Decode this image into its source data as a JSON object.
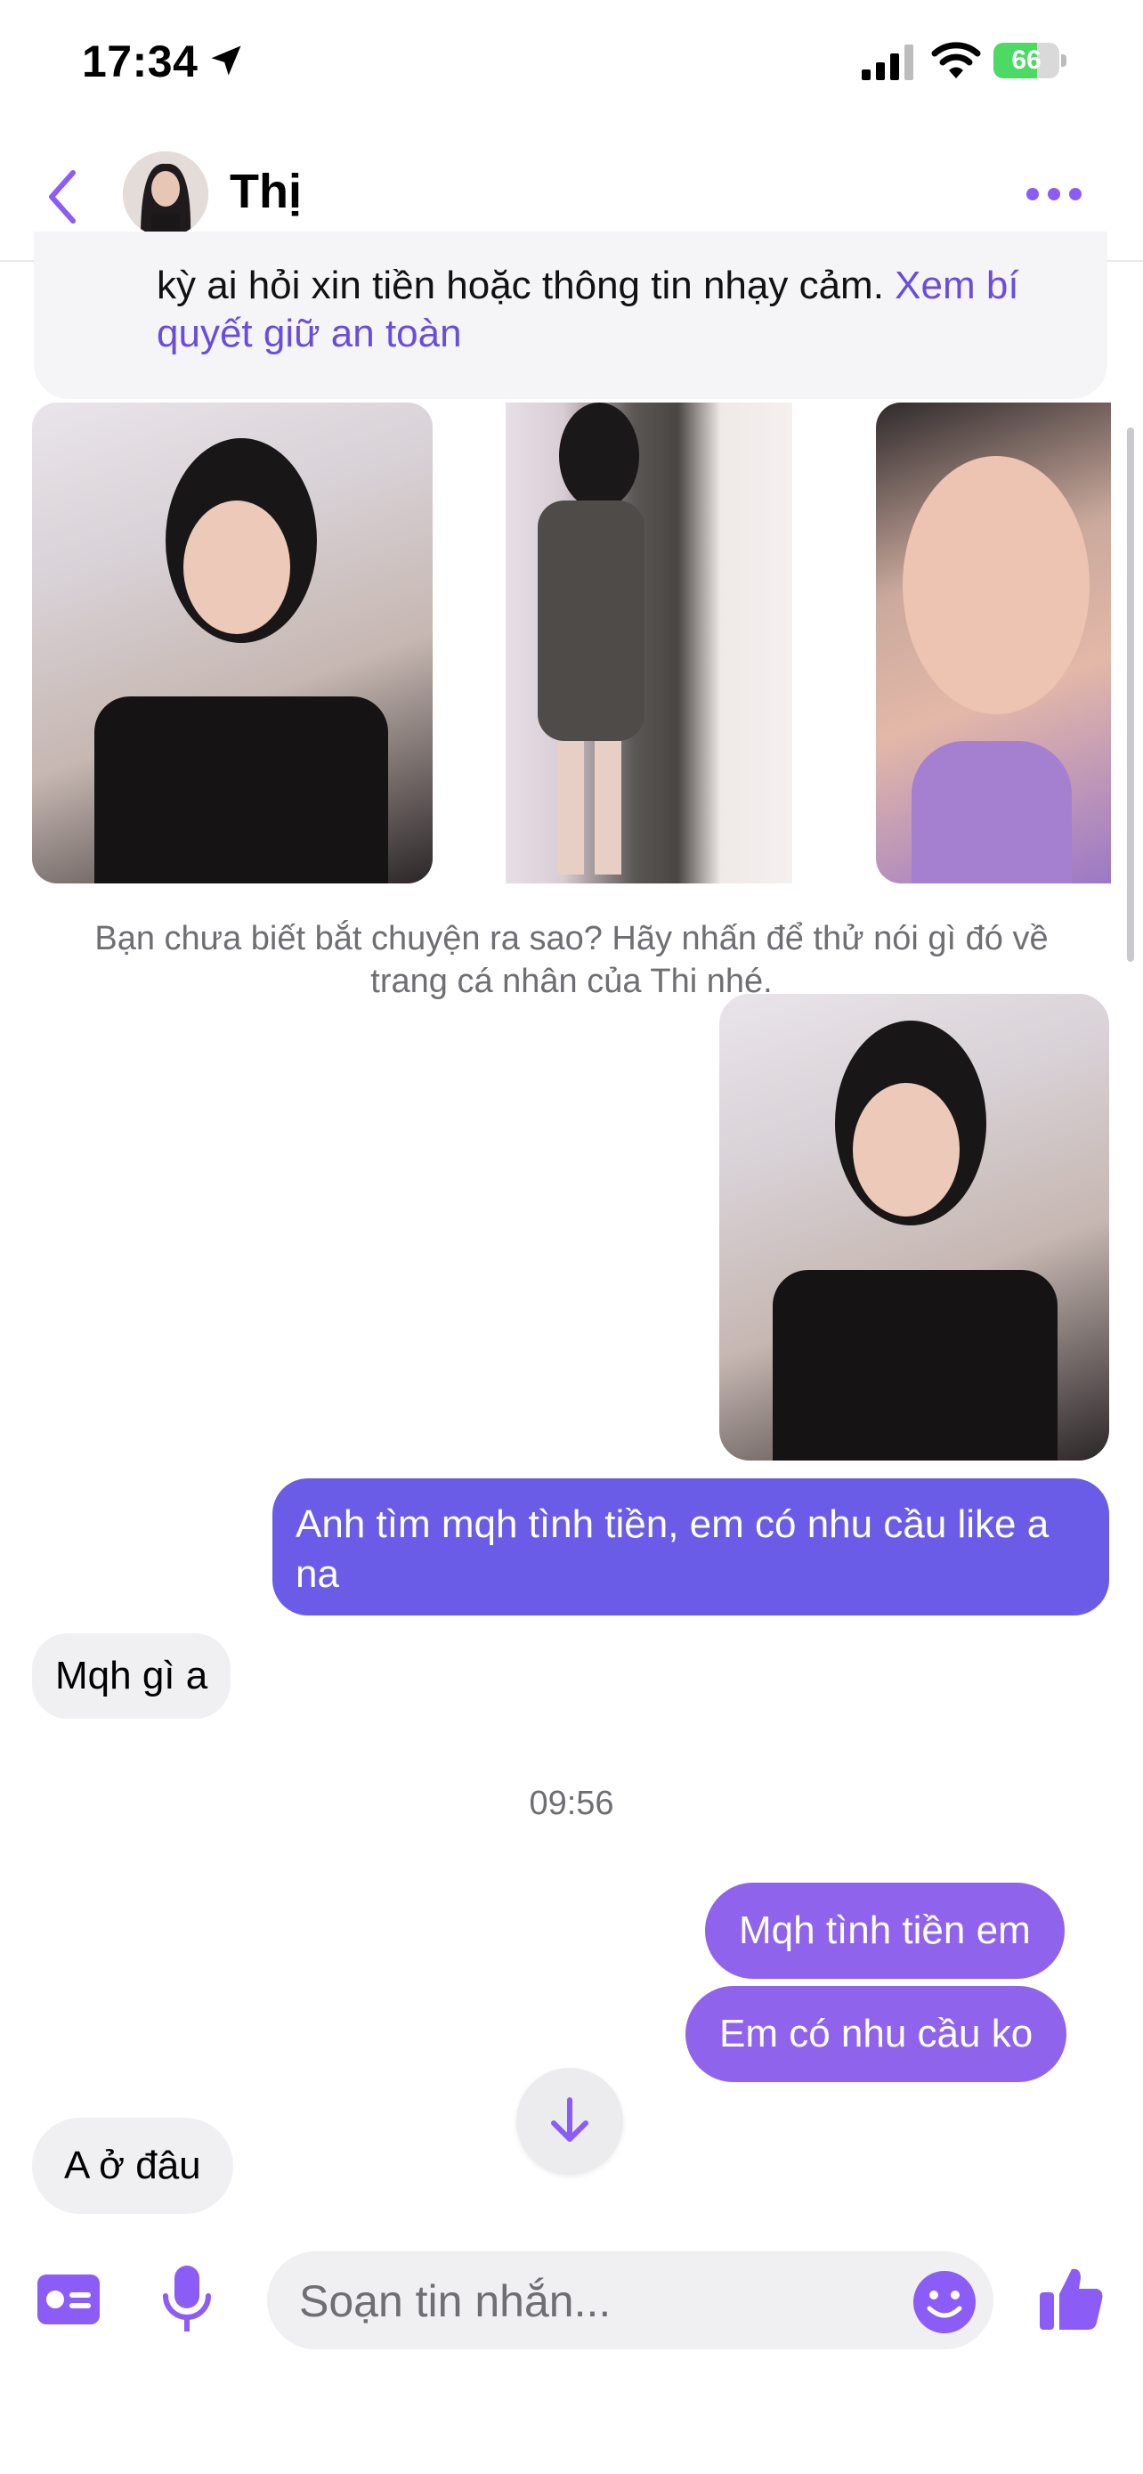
{
  "status_bar": {
    "time": "17:34",
    "battery": "66",
    "battery_level": 0.66
  },
  "header": {
    "contact_name": "Thị"
  },
  "safety_notice": {
    "text": "kỳ ai hỏi xin tiền hoặc thông tin nhạy cảm.",
    "link": "Xem bí quyết giữ an toàn"
  },
  "profile_hint": "Bạn chưa biết bắt chuyện ra sao? Hãy nhấn để thử nói gì đó về trang cá nhân của Thi nhé.",
  "messages": [
    {
      "from": "me",
      "text": "Anh tìm mqh tình tiền, em có nhu cầu like a na"
    },
    {
      "from": "them",
      "text": "Mqh gì a"
    },
    {
      "from": "me",
      "text": "Mqh tình tiền em"
    },
    {
      "from": "me",
      "text": "Em có nhu cầu ko"
    },
    {
      "from": "them",
      "text": "A ở đâu"
    }
  ],
  "timestamp": "09:56",
  "composer": {
    "placeholder": "Soạn tin nhắn..."
  },
  "colors": {
    "accent": "#8b5cf6",
    "outgoing_bubble": "#6a5ce6",
    "outgoing_bubble_light": "#8f63ec",
    "incoming_bubble": "#f0f0f2"
  },
  "icons": [
    "location-arrow-icon",
    "signal-icon",
    "wifi-icon",
    "battery-icon",
    "back-icon",
    "more-icon",
    "arrow-down-icon",
    "contact-card-icon",
    "microphone-icon",
    "emoji-icon",
    "thumbs-up-icon"
  ]
}
